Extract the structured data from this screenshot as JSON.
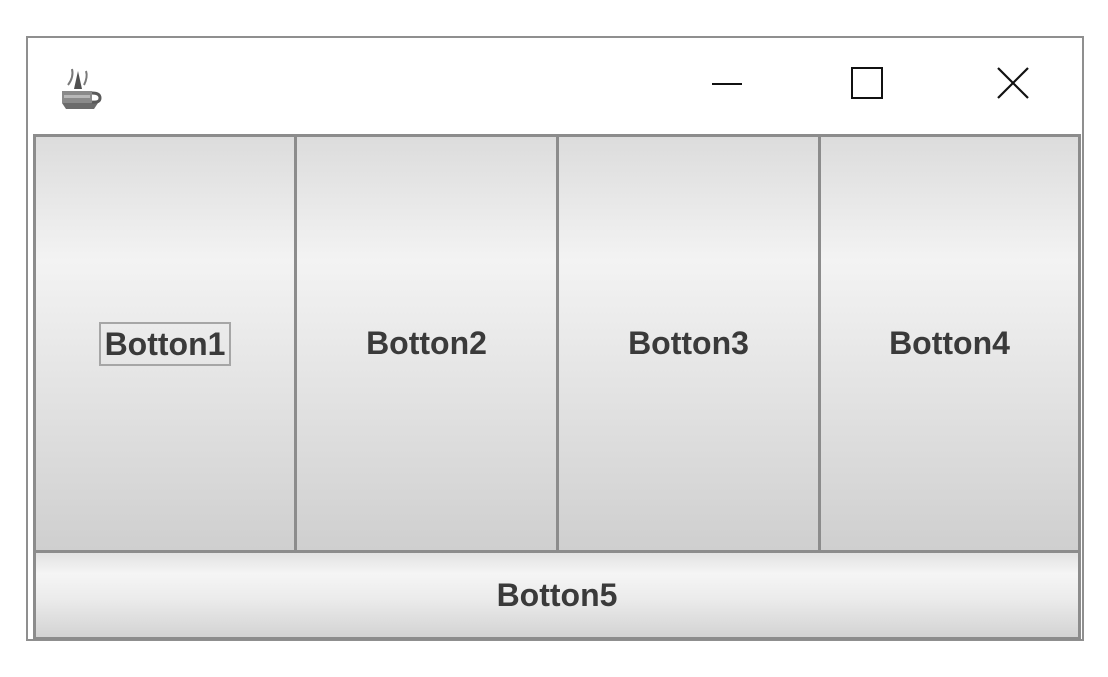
{
  "window": {
    "buttons": [
      {
        "id": "b1",
        "label": "Botton1",
        "focused": true
      },
      {
        "id": "b2",
        "label": "Botton2"
      },
      {
        "id": "b3",
        "label": "Botton3"
      },
      {
        "id": "b4",
        "label": "Botton4"
      },
      {
        "id": "b5",
        "label": "Botton5"
      }
    ],
    "titlebar": {
      "app_icon": "java-cup-icon",
      "controls": [
        "minimize-icon",
        "maximize-icon",
        "close-icon"
      ]
    }
  },
  "colors": {
    "border": "#8c8c8c",
    "text": "#3a3a3a",
    "titlebar_bg": "#ffffff"
  }
}
